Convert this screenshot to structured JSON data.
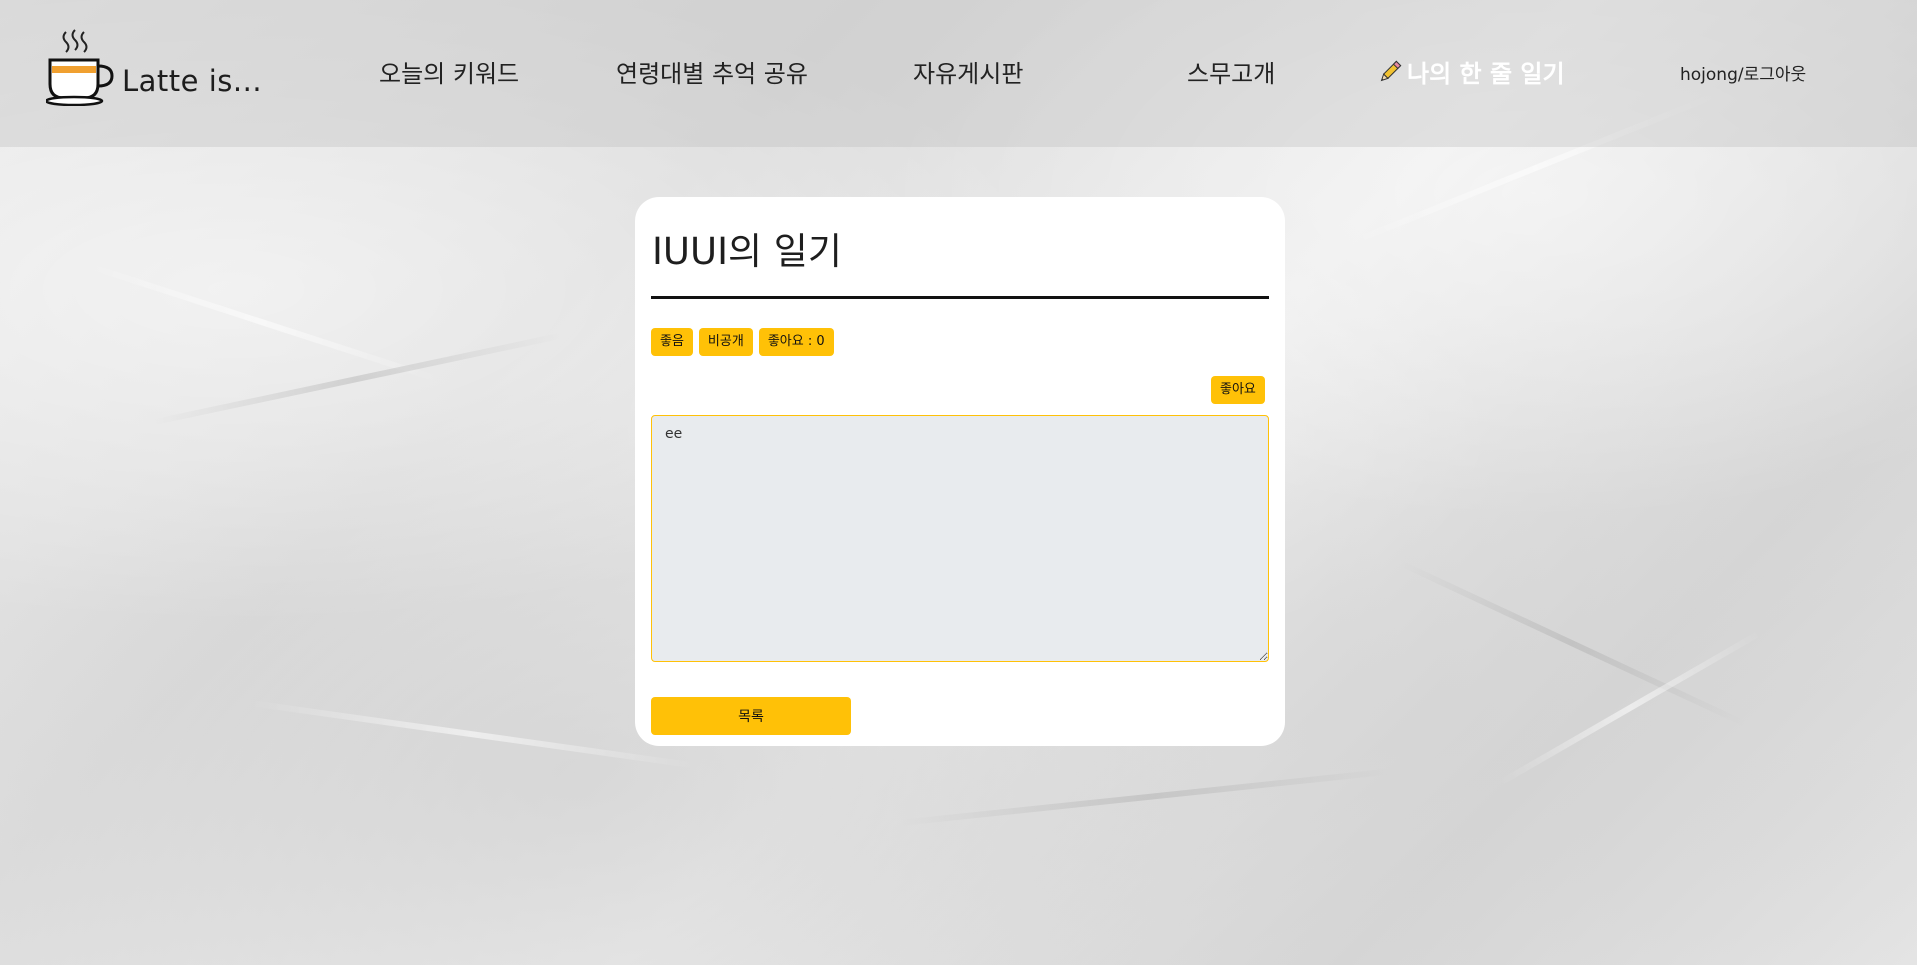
{
  "brand": {
    "logo_text": "Latte is..."
  },
  "nav": {
    "items": [
      {
        "label": "오늘의 키워드"
      },
      {
        "label": "연령대별 추억 공유"
      },
      {
        "label": "자유게시판"
      },
      {
        "label": "스무고개"
      },
      {
        "label": "나의 한 줄 일기",
        "active": true
      }
    ],
    "user_logout": "hojong/로그아웃"
  },
  "diary": {
    "title": "IUUI의 일기",
    "mood_badge": "좋음",
    "visibility_badge": "비공개",
    "likes_badge": "좋아요 : 0",
    "like_button": "좋아요",
    "content": "ee",
    "list_button": "목록"
  },
  "colors": {
    "accent": "#ffc107",
    "textarea_bg": "#e8ebee",
    "active_nav": "#ffffff"
  }
}
